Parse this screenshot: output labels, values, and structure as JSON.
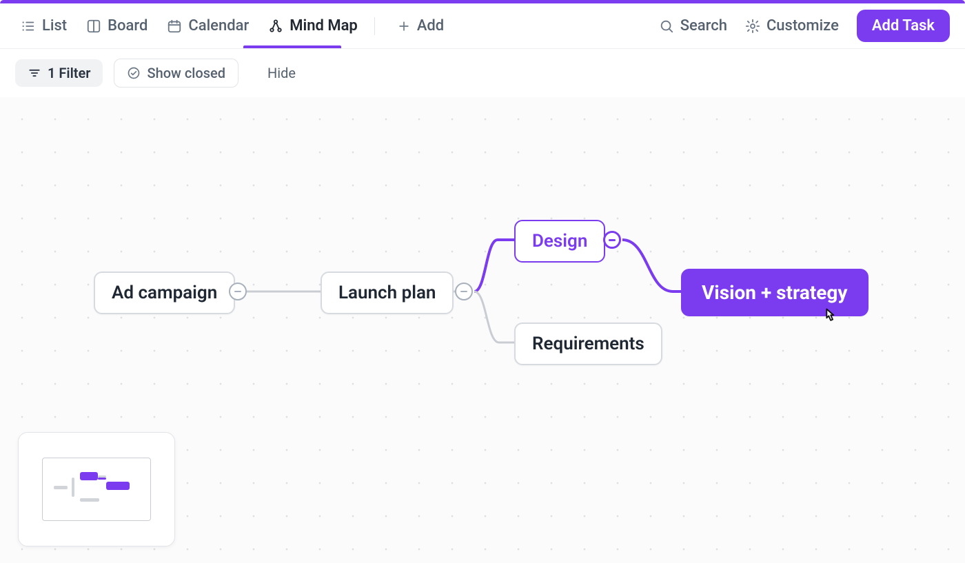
{
  "tabs": {
    "list": "List",
    "board": "Board",
    "calendar": "Calendar",
    "mindmap": "Mind Map",
    "add": "Add"
  },
  "actions": {
    "search": "Search",
    "customize": "Customize",
    "add_task": "Add Task"
  },
  "filters": {
    "filter_label": "1 Filter",
    "show_closed_label": "Show closed",
    "hide_label": "Hide"
  },
  "nodes": {
    "ad_campaign": "Ad campaign",
    "launch_plan": "Launch plan",
    "design": "Design",
    "requirements": "Requirements",
    "vision": "Vision + strategy"
  }
}
